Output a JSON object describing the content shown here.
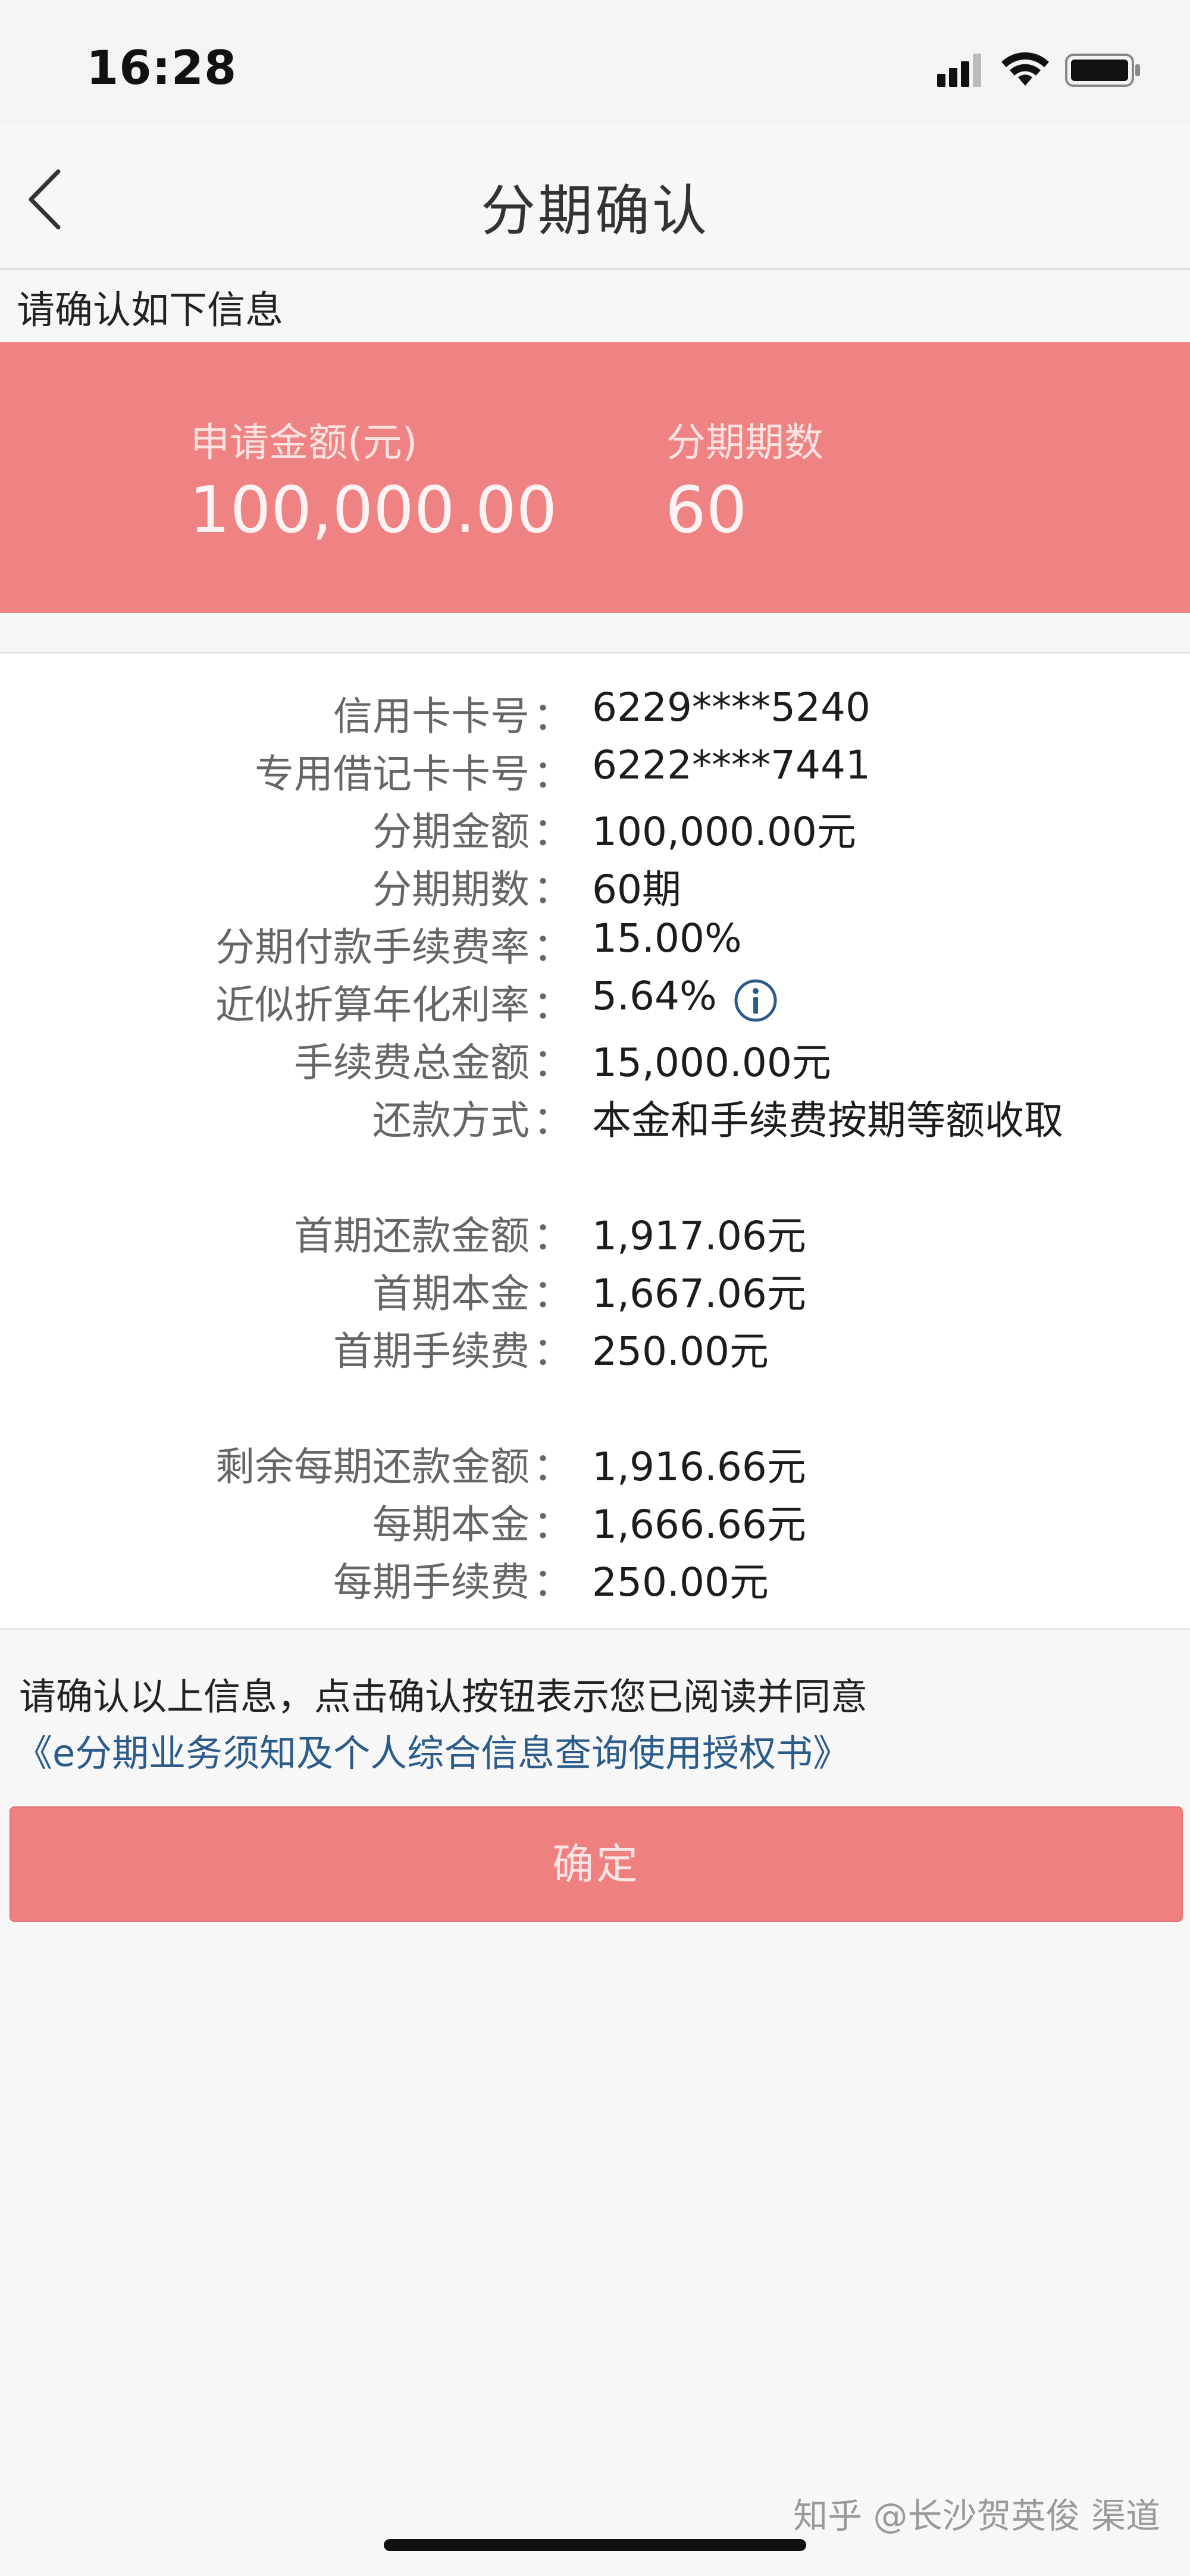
{
  "status_bar": {
    "time": "16:28"
  },
  "nav": {
    "title": "分期确认"
  },
  "confirm_hint": "请确认如下信息",
  "banner": {
    "amount_label": "申请金额(元)",
    "amount_value": "100,000.00",
    "periods_label": "分期期数",
    "periods_value": "60"
  },
  "details": [
    {
      "label": "信用卡卡号",
      "value": "6229****5240"
    },
    {
      "label": "专用借记卡卡号",
      "value": "6222****7441"
    },
    {
      "label": "分期金额",
      "value": "100,000.00元"
    },
    {
      "label": "分期期数",
      "value": "60期"
    },
    {
      "label": "分期付款手续费率",
      "value": "15.00%"
    },
    {
      "label": "近似折算年化利率",
      "value": "5.64%"
    },
    {
      "label": "手续费总金额",
      "value": "15,000.00元"
    },
    {
      "label": "还款方式",
      "value": "本金和手续费按期等额收取"
    },
    {
      "label": "首期还款金额",
      "value": "1,917.06元"
    },
    {
      "label": "首期本金",
      "value": "1,667.06元"
    },
    {
      "label": "首期手续费",
      "value": "250.00元"
    },
    {
      "label": "剩余每期还款金额",
      "value": "1,916.66元"
    },
    {
      "label": "每期本金",
      "value": "1,666.66元"
    },
    {
      "label": "每期手续费",
      "value": "250.00元"
    }
  ],
  "colon": "：",
  "agreement": {
    "text": "请确认以上信息，点击确认按钮表示您已阅读并同意",
    "link": "《e分期业务须知及个人综合信息查询使用授权书》"
  },
  "confirm_button": "确定",
  "watermark": "知乎 @长沙贺英俊 渠道",
  "colors": {
    "banner": "#ef8383",
    "button": "#ef8080",
    "link": "#2a5b8a"
  },
  "icons": [
    "signal-icon",
    "wifi-icon",
    "battery-icon",
    "back-chevron-icon",
    "info-icon"
  ]
}
